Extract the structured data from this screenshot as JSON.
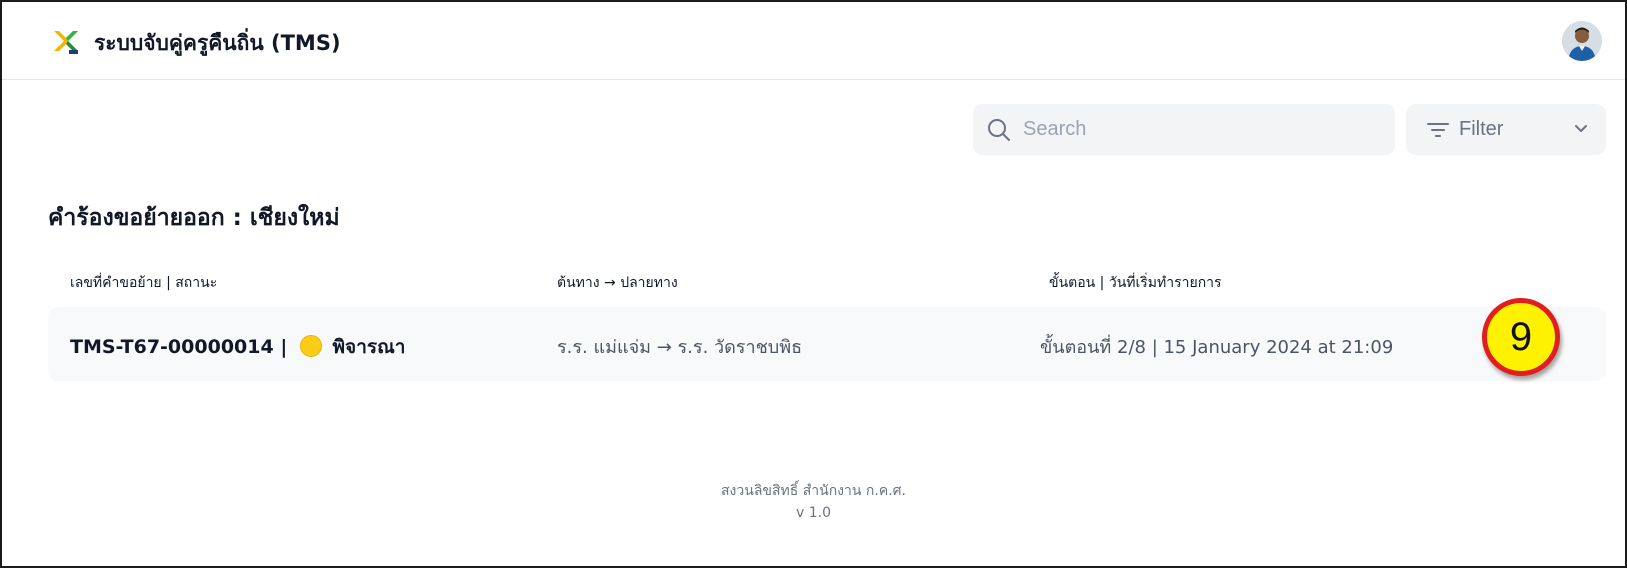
{
  "header": {
    "logo_icon": "tms-logo-icon",
    "title": "ระบบจับคู่ครูคืนถิ่น (TMS)",
    "avatar_icon": "user-avatar"
  },
  "toolbar": {
    "search_placeholder": "Search",
    "search_value": "",
    "filter_label": "Filter"
  },
  "page": {
    "title": "คำร้องขอย้ายออก  : เชียงใหม่"
  },
  "table": {
    "headers": [
      "เลขที่คำขอย้าย | สถานะ",
      "ต้นทาง → ปลายทาง",
      "ขั้นตอน | วันที่เริ่มทำรายการ"
    ],
    "rows": [
      {
        "request_id": "TMS-T67-00000014",
        "status": "พิจารณา",
        "status_color": "#facc15",
        "route": "ร.ร. แม่แจ่ม → ร.ร. วัดราชบพิธ",
        "step_date": "ขั้นตอนที่ 2/8 | 15 January 2024 at 21:09"
      }
    ]
  },
  "annotation": {
    "badge_number": "9",
    "badge_color": "#fff200",
    "badge_border": "#e11d1d"
  },
  "footer": {
    "copyright": "สงวนลิขสิทธิ์ สำนักงาน ก.ค.ศ.",
    "version": "v 1.0"
  }
}
